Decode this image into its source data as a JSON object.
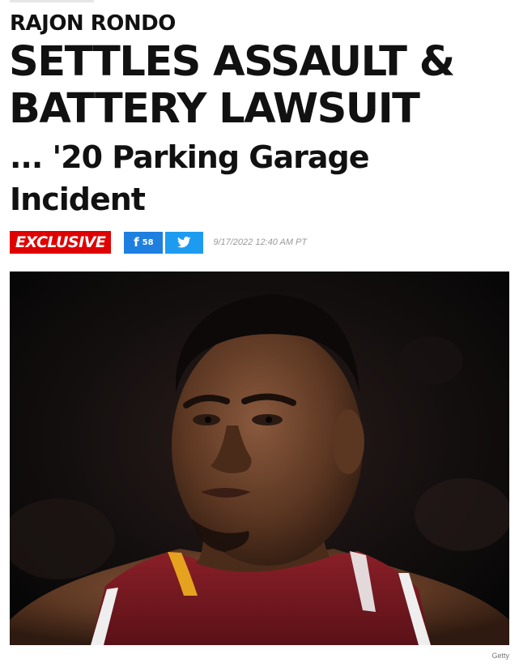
{
  "article": {
    "kicker": "RAJON RONDO",
    "headline": "SETTLES ASSAULT & BATTERY LAWSUIT",
    "subhead": "... '20 Parking Garage Incident",
    "badge": "EXCLUSIVE",
    "share": {
      "facebook_count": "58",
      "facebook_icon": "f",
      "twitter_icon": "twitter-bird"
    },
    "timestamp": "9/17/2022 12:40 AM PT",
    "photo_credit": "Getty"
  },
  "colors": {
    "badge": "#e00000",
    "facebook": "#1e7fe0",
    "twitter": "#1d9bf0",
    "jersey": "#7a1a22",
    "jersey_trim": "#e5a21e"
  }
}
